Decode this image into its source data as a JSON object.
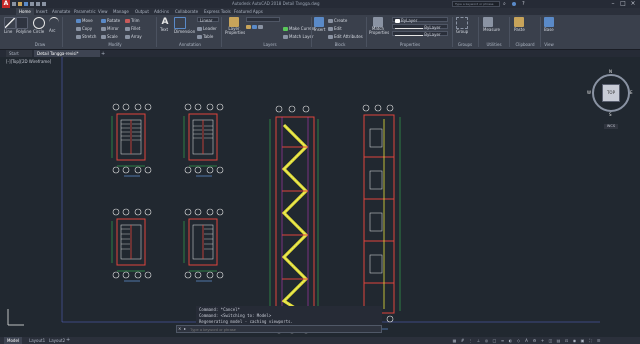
{
  "app": {
    "title": "Autodesk AutoCAD 2018   Detail Tangga.dwg",
    "search_placeholder": "Type a keyword or phrase"
  },
  "ribbon_tabs": [
    "Home",
    "Insert",
    "Annotate",
    "Parametric",
    "View",
    "Manage",
    "Output",
    "Add-ins",
    "Collaborate",
    "Express Tools",
    "Featured Apps"
  ],
  "ribbon": {
    "draw": {
      "line": "Line",
      "polyline": "Polyline",
      "circle": "Circle",
      "arc": "Arc",
      "title": "Draw"
    },
    "modify": {
      "move": "Move",
      "copy": "Copy",
      "stretch": "Stretch",
      "rotate": "Rotate",
      "mirror": "Mirror",
      "scale": "Scale",
      "trim": "Trim",
      "fillet": "Fillet",
      "array": "Array",
      "title": "Modify"
    },
    "annotation": {
      "text": "Text",
      "dimension": "Dimension",
      "linear": "Linear",
      "leader": "Leader",
      "table": "Table",
      "title": "Annotation"
    },
    "layers": {
      "layer_properties": "Layer Properties",
      "make_current": "Make Current",
      "match_layer": "Match Layer",
      "title": "Layers"
    },
    "block": {
      "insert": "Insert",
      "create": "Create",
      "edit": "Edit",
      "edit_attributes": "Edit Attributes",
      "title": "Block"
    },
    "properties": {
      "match": "Match Properties",
      "bylayer": "ByLayer",
      "title": "Properties"
    },
    "groups": {
      "group": "Group",
      "title": "Groups"
    },
    "utilities": {
      "measure": "Measure",
      "title": "Utilities"
    },
    "clipboard": {
      "paste": "Paste",
      "title": "Clipboard"
    },
    "view": {
      "base": "Base",
      "title": "View"
    }
  },
  "doc_tabs": [
    "Start",
    "Detail Tangga-revisi*"
  ],
  "viewport_label": "[-][Top][2D Wireframe]",
  "viewcube": {
    "top_face": "TOP",
    "n": "N",
    "s": "S",
    "e": "E",
    "w": "W",
    "wcs": "WCS"
  },
  "command_history": [
    "Command: *Cancel*",
    "Command:  <Switching to: Model>",
    "Regenerating model - caching viewports."
  ],
  "status_tabs": [
    "Model",
    "Layout1",
    "Layout2"
  ],
  "colors": {
    "accent": "#c62828",
    "line_yellow": "#e6e33a",
    "line_red": "#e0443c",
    "line_green": "#3bd45a",
    "line_white": "#e6e6e6",
    "line_magenta": "#d23cd2"
  }
}
